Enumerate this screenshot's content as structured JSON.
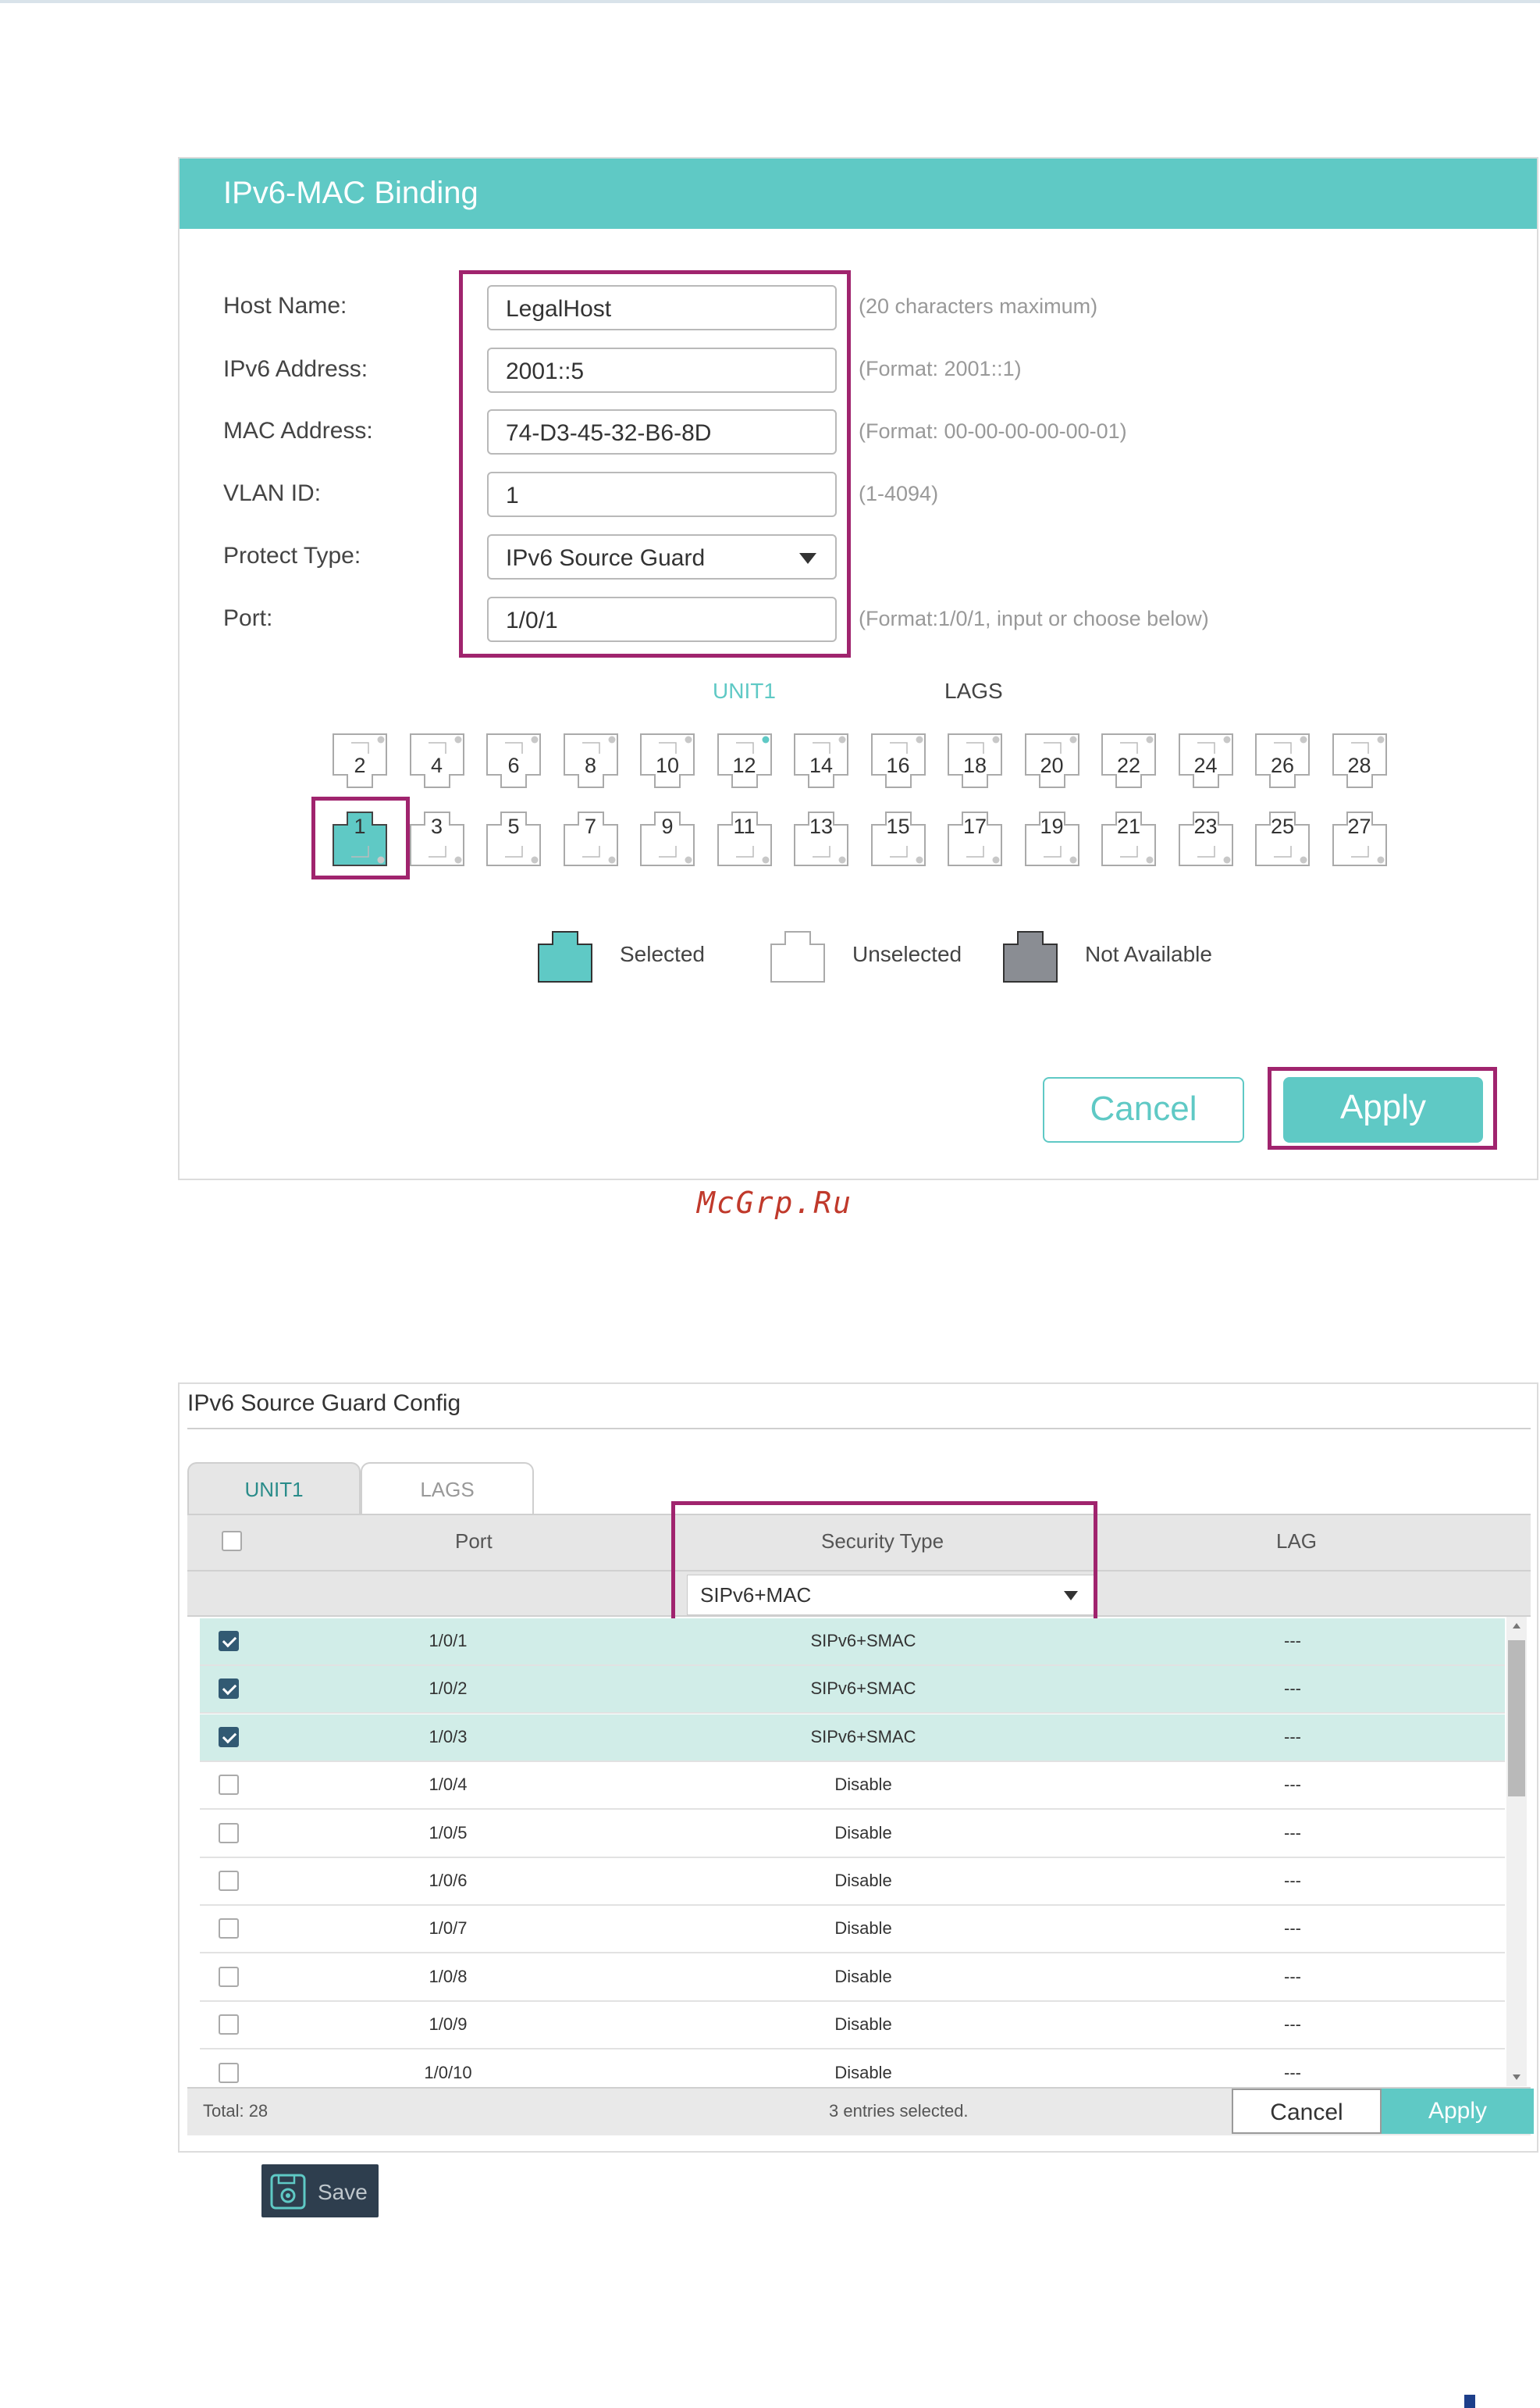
{
  "binding": {
    "title": "IPv6-MAC Binding",
    "fields": [
      {
        "label": "Host Name:",
        "value": "LegalHost",
        "hint": "(20 characters maximum)"
      },
      {
        "label": "IPv6 Address:",
        "value": "2001::5",
        "hint": "(Format: 2001::1)"
      },
      {
        "label": "MAC Address:",
        "value": "74-D3-45-32-B6-8D",
        "hint": "(Format: 00-00-00-00-00-01)"
      },
      {
        "label": "VLAN ID:",
        "value": "1",
        "hint": "(1-4094)"
      },
      {
        "label": "Protect Type:",
        "value": "IPv6 Source Guard",
        "hint": ""
      },
      {
        "label": "Port:",
        "value": "1/0/1",
        "hint": "(Format:1/0/1, input or choose below)"
      }
    ],
    "tabs": {
      "unit": "UNIT1",
      "lags": "LAGS"
    },
    "ports_top": [
      "2",
      "4",
      "6",
      "8",
      "10",
      "12",
      "14",
      "16",
      "18",
      "20",
      "22",
      "24",
      "26",
      "28"
    ],
    "ports_bottom": [
      "1",
      "3",
      "5",
      "7",
      "9",
      "11",
      "13",
      "15",
      "17",
      "19",
      "21",
      "23",
      "25",
      "27"
    ],
    "selected_port": "1",
    "legend": {
      "selected": "Selected",
      "unselected": "Unselected",
      "not_available": "Not Available"
    },
    "buttons": {
      "cancel": "Cancel",
      "apply": "Apply"
    }
  },
  "watermark": "McGrp.Ru",
  "guard": {
    "title": "IPv6 Source Guard Config",
    "tabs": {
      "unit": "UNIT1",
      "lags": "LAGS"
    },
    "columns": {
      "port": "Port",
      "security_type": "Security Type",
      "lag": "LAG"
    },
    "filter_value": "SIPv6+MAC",
    "rows": [
      {
        "port": "1/0/1",
        "type": "SIPv6+SMAC",
        "lag": "---",
        "checked": true
      },
      {
        "port": "1/0/2",
        "type": "SIPv6+SMAC",
        "lag": "---",
        "checked": true
      },
      {
        "port": "1/0/3",
        "type": "SIPv6+SMAC",
        "lag": "---",
        "checked": true
      },
      {
        "port": "1/0/4",
        "type": "Disable",
        "lag": "---",
        "checked": false
      },
      {
        "port": "1/0/5",
        "type": "Disable",
        "lag": "---",
        "checked": false
      },
      {
        "port": "1/0/6",
        "type": "Disable",
        "lag": "---",
        "checked": false
      },
      {
        "port": "1/0/7",
        "type": "Disable",
        "lag": "---",
        "checked": false
      },
      {
        "port": "1/0/8",
        "type": "Disable",
        "lag": "---",
        "checked": false
      },
      {
        "port": "1/0/9",
        "type": "Disable",
        "lag": "---",
        "checked": false
      },
      {
        "port": "1/0/10",
        "type": "Disable",
        "lag": "---",
        "checked": false
      }
    ],
    "total": "Total: 28",
    "selected_text": "3 entries selected.",
    "buttons": {
      "cancel": "Cancel",
      "apply": "Apply"
    }
  },
  "save": {
    "label": "Save",
    "icon": "save-gear-icon"
  },
  "colors": {
    "teal": "#5fc9c5",
    "highlight": "#a0246e",
    "selected_row": "#d1ede8"
  }
}
